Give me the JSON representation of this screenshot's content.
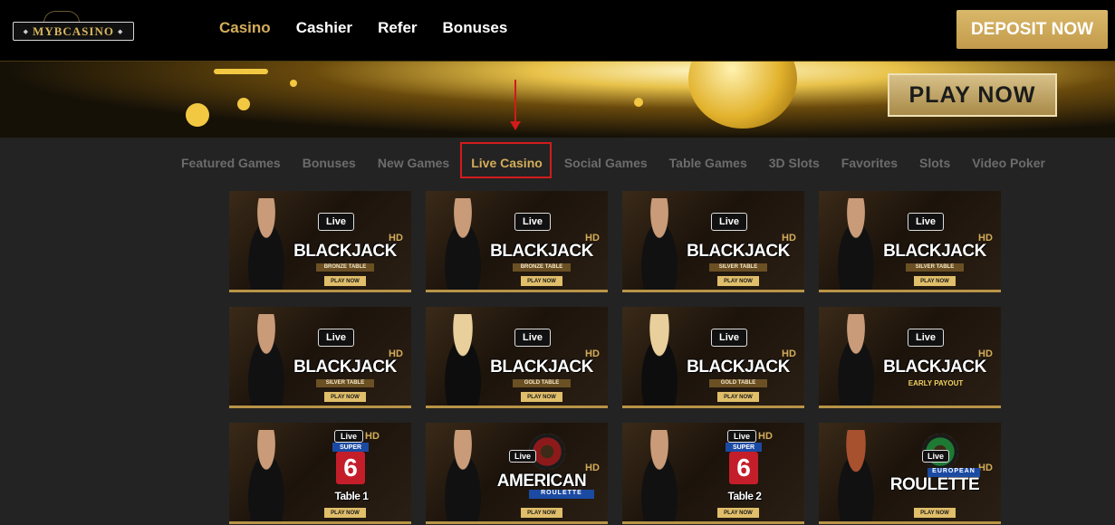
{
  "logo": {
    "text": "MYBCASINO"
  },
  "nav": {
    "items": [
      "Casino",
      "Cashier",
      "Refer",
      "Bonuses"
    ],
    "active": "Casino"
  },
  "deposit_label": "DEPOSIT NOW",
  "banner": {
    "play_label": "PLAY NOW"
  },
  "tabs": [
    "Featured Games",
    "Bonuses",
    "New Games",
    "Live Casino",
    "Social Games",
    "Table Games",
    "3D Slots",
    "Favorites",
    "Slots",
    "Video Poker"
  ],
  "active_tab": "Live Casino",
  "games": [
    {
      "live": "Live",
      "hd": "HD",
      "title": "BLACKJACK",
      "sub": "BRONZE TABLE",
      "play": "PLAY NOW",
      "model": "brunette",
      "kind": "blackjack"
    },
    {
      "live": "Live",
      "hd": "HD",
      "title": "BLACKJACK",
      "sub": "BRONZE TABLE",
      "play": "PLAY NOW",
      "model": "brunette",
      "kind": "blackjack"
    },
    {
      "live": "Live",
      "hd": "HD",
      "title": "BLACKJACK",
      "sub": "SILVER TABLE",
      "play": "PLAY NOW",
      "model": "brunette",
      "kind": "blackjack"
    },
    {
      "live": "Live",
      "hd": "HD",
      "title": "BLACKJACK",
      "sub": "SILVER TABLE",
      "play": "PLAY NOW",
      "model": "brunette",
      "kind": "blackjack"
    },
    {
      "live": "Live",
      "hd": "HD",
      "title": "BLACKJACK",
      "sub": "SILVER TABLE",
      "play": "PLAY NOW",
      "model": "brunette",
      "kind": "blackjack"
    },
    {
      "live": "Live",
      "hd": "HD",
      "title": "BLACKJACK",
      "sub": "GOLD TABLE",
      "play": "PLAY NOW",
      "model": "blonde",
      "kind": "blackjack"
    },
    {
      "live": "Live",
      "hd": "HD",
      "title": "BLACKJACK",
      "sub": "GOLD TABLE",
      "play": "PLAY NOW",
      "model": "blonde",
      "kind": "blackjack"
    },
    {
      "live": "Live",
      "hd": "HD",
      "title": "BLACKJACK",
      "sub": "EARLY PAYOUT",
      "play": "",
      "model": "brunette",
      "kind": "blackjack-plain"
    },
    {
      "live": "Live",
      "hd": "HD",
      "super": "SUPER",
      "six": "6",
      "title": "Table 1",
      "sub": "",
      "play": "PLAY NOW",
      "model": "brunette",
      "kind": "super6"
    },
    {
      "live": "Live",
      "hd": "HD",
      "title": "AMERICAN",
      "tag": "ROULETTE",
      "sub": "",
      "play": "PLAY NOW",
      "model": "brunette",
      "kind": "roulette"
    },
    {
      "live": "Live",
      "hd": "HD",
      "super": "SUPER",
      "six": "6",
      "title": "Table 2",
      "sub": "",
      "play": "PLAY NOW",
      "model": "brunette",
      "kind": "super6"
    },
    {
      "live": "Live",
      "hd": "HD",
      "title": "ROULETTE",
      "tag": "EUROPEAN",
      "sub": "",
      "play": "PLAY NOW",
      "model": "red",
      "kind": "euro-roulette"
    }
  ]
}
